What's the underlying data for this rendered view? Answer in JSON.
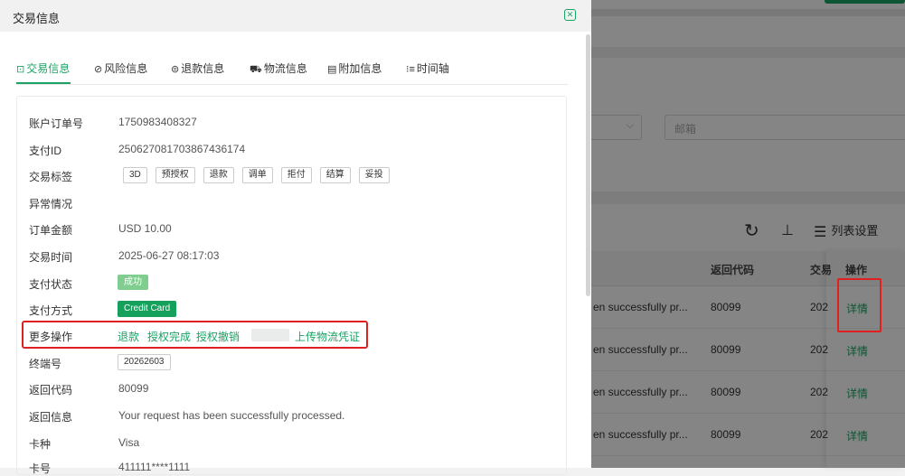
{
  "drawer": {
    "title": "交易信息"
  },
  "tabs": [
    {
      "icon": "⊡",
      "label": "交易信息"
    },
    {
      "icon": "⊘",
      "label": "风险信息"
    },
    {
      "icon": "⊜",
      "label": "退款信息"
    },
    {
      "icon": "⛟",
      "label": "物流信息"
    },
    {
      "icon": "▤",
      "label": "附加信息"
    },
    {
      "icon": "⁝≡",
      "label": "时间轴"
    }
  ],
  "fields": {
    "account_order_no": {
      "label": "账户订单号",
      "value": "1750983408327"
    },
    "payment_id": {
      "label": "支付ID",
      "value": "250627081703867436174"
    },
    "tx_tags": {
      "label": "交易标签",
      "tags": [
        "3D",
        "预授权",
        "退款",
        "调单",
        "拒付",
        "结算",
        "妥投"
      ]
    },
    "exception": {
      "label": "异常情况",
      "value": ""
    },
    "order_amount": {
      "label": "订单金额",
      "value": "USD 10.00"
    },
    "tx_time": {
      "label": "交易时间",
      "value": "2025-06-27 08:17:03"
    },
    "pay_status": {
      "label": "支付状态",
      "value": "成功"
    },
    "pay_method": {
      "label": "支付方式",
      "value": "Credit Card"
    },
    "more_ops": {
      "label": "更多操作",
      "links": [
        "退款",
        "授权完成",
        "授权撤销",
        "上传物流凭证"
      ]
    },
    "terminal_no": {
      "label": "终端号",
      "value": "20262603"
    },
    "return_code": {
      "label": "返回代码",
      "value": "80099"
    },
    "return_msg": {
      "label": "返回信息",
      "value": "Your request has been successfully processed."
    },
    "card_type": {
      "label": "卡种",
      "value": "Visa"
    },
    "card_no": {
      "label": "卡号",
      "value": "411111****1111"
    }
  },
  "background": {
    "email_placeholder": "邮箱",
    "column_settings": "列表设置",
    "columns": {
      "return_code": "返回代码",
      "tx": "交易",
      "ops": "操作"
    },
    "rows": [
      {
        "message": "en successfully pr...",
        "code": "80099",
        "time": "202",
        "action": "详情"
      },
      {
        "message": "en successfully pr...",
        "code": "80099",
        "time": "202",
        "action": "详情"
      },
      {
        "message": "en successfully pr...",
        "code": "80099",
        "time": "202",
        "action": "详情"
      },
      {
        "message": "en successfully pr...",
        "code": "80099",
        "time": "202",
        "action": "详情"
      }
    ]
  },
  "colors": {
    "accent": "#19a464",
    "highlight": "#e02020"
  }
}
